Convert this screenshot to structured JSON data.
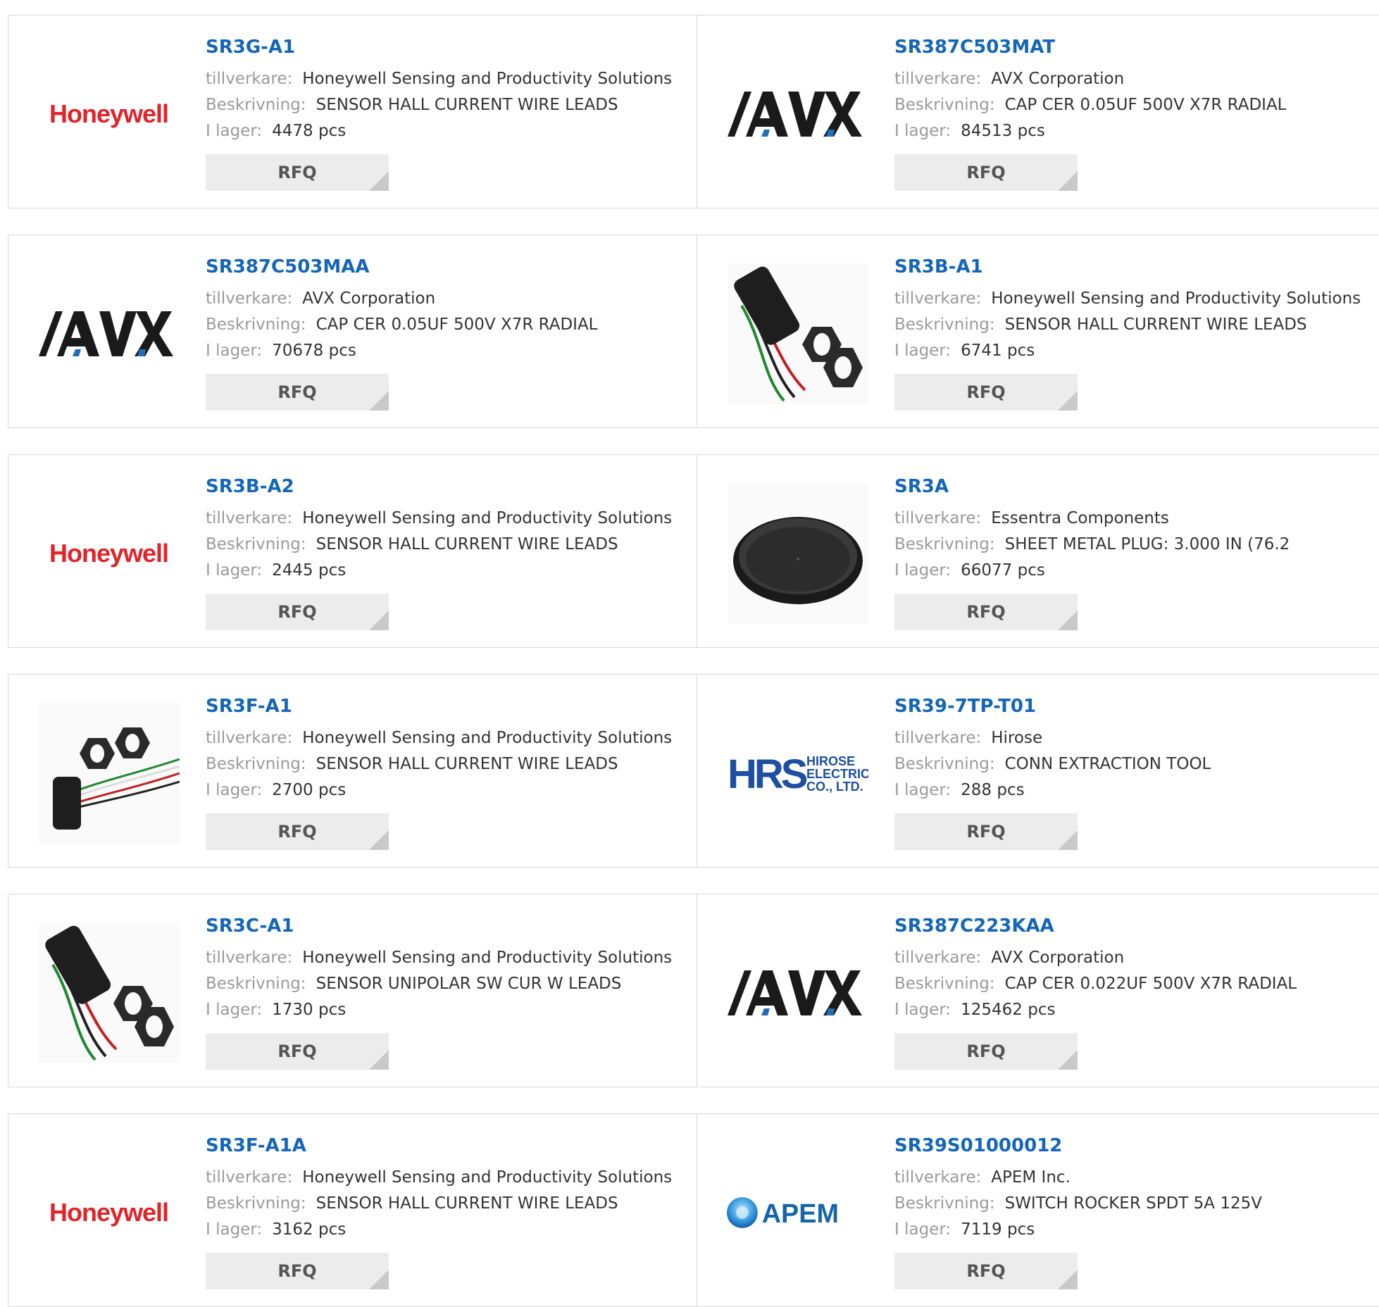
{
  "labels": {
    "manufacturer": "tillverkare:",
    "description": "Beskrivning:",
    "stock": "I lager:",
    "rfq": "RFQ"
  },
  "brand_colors": {
    "link": "#1466b8",
    "honeywell": "#e1232a",
    "hirose": "#1e4fa0",
    "apem": "#1565a8"
  },
  "products": [
    {
      "part": "SR3G-A1",
      "manufacturer": "Honeywell Sensing and Productivity Solutions",
      "description": "SENSOR HALL CURRENT WIRE LEADS",
      "stock": "4478 pcs",
      "image": "honeywell-logo",
      "logo_text": "Honeywell"
    },
    {
      "part": "SR387C503MAT",
      "manufacturer": "AVX Corporation",
      "description": "CAP CER 0.05UF 500V X7R RADIAL",
      "stock": "84513 pcs",
      "image": "avx-logo",
      "logo_text": "AVX"
    },
    {
      "part": "SR387C503MAA",
      "manufacturer": "AVX Corporation",
      "description": "CAP CER 0.05UF 500V X7R RADIAL",
      "stock": "70678 pcs",
      "image": "avx-logo",
      "logo_text": "AVX"
    },
    {
      "part": "SR3B-A1",
      "manufacturer": "Honeywell Sensing and Productivity Solutions",
      "description": "SENSOR HALL CURRENT WIRE LEADS",
      "stock": "6741 pcs",
      "image": "hall-sensor-photo"
    },
    {
      "part": "SR3B-A2",
      "manufacturer": "Honeywell Sensing and Productivity Solutions",
      "description": "SENSOR HALL CURRENT WIRE LEADS",
      "stock": "2445 pcs",
      "image": "honeywell-logo",
      "logo_text": "Honeywell"
    },
    {
      "part": "SR3A",
      "manufacturer": "Essentra Components",
      "description": "SHEET METAL PLUG: 3.000 IN (76.2",
      "stock": "66077 pcs",
      "image": "plug-photo"
    },
    {
      "part": "SR3F-A1",
      "manufacturer": "Honeywell Sensing and Productivity Solutions",
      "description": "SENSOR HALL CURRENT WIRE LEADS",
      "stock": "2700 pcs",
      "image": "hall-sensor-photo-alt"
    },
    {
      "part": "SR39-7TP-T01",
      "manufacturer": "Hirose",
      "description": "CONN EXTRACTION TOOL",
      "stock": "288 pcs",
      "image": "hirose-logo",
      "logo_text": "HRS",
      "logo_subtext": [
        "HIROSE",
        "ELECTRIC",
        "CO., LTD."
      ]
    },
    {
      "part": "SR3C-A1",
      "manufacturer": "Honeywell Sensing and Productivity Solutions",
      "description": "SENSOR UNIPOLAR SW CUR W LEADS",
      "stock": "1730 pcs",
      "image": "hall-sensor-photo"
    },
    {
      "part": "SR387C223KAA",
      "manufacturer": "AVX Corporation",
      "description": "CAP CER 0.022UF 500V X7R RADIAL",
      "stock": "125462 pcs",
      "image": "avx-logo",
      "logo_text": "AVX"
    },
    {
      "part": "SR3F-A1A",
      "manufacturer": "Honeywell Sensing and Productivity Solutions",
      "description": "SENSOR HALL CURRENT WIRE LEADS",
      "stock": "3162 pcs",
      "image": "honeywell-logo",
      "logo_text": "Honeywell"
    },
    {
      "part": "SR39S01000012",
      "manufacturer": "APEM Inc.",
      "description": "SWITCH ROCKER SPDT 5A 125V",
      "stock": "7119 pcs",
      "image": "apem-logo",
      "logo_text": "APEM"
    }
  ]
}
